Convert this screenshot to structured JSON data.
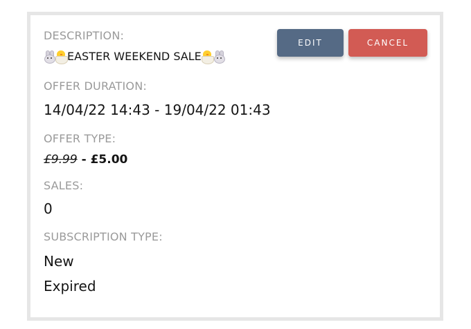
{
  "offer": {
    "description_label": "DESCRIPTION:",
    "description_value": "EASTER WEEKEND SALE",
    "duration_label": "OFFER DURATION:",
    "duration_value": "14/04/22 14:43 - 19/04/22 01:43",
    "type_label": "OFFER TYPE:",
    "original_price": "£9.99",
    "price_separator": " - ",
    "sale_price": "£5.00",
    "sales_label": "SALES:",
    "sales_value": "0",
    "subscription_label": "SUBSCRIPTION TYPE:",
    "subscription_types": [
      "New",
      "Expired"
    ]
  },
  "actions": {
    "edit_label": "EDIT",
    "cancel_label": "CANCEL"
  },
  "icons": {
    "description_emojis": [
      "bunny-icon",
      "chick-icon",
      "chick-icon",
      "bunny-icon"
    ]
  },
  "colors": {
    "edit_button": "#556a85",
    "cancel_button": "#d25b54",
    "label_text": "#9a9a9a",
    "value_text": "#141414"
  }
}
